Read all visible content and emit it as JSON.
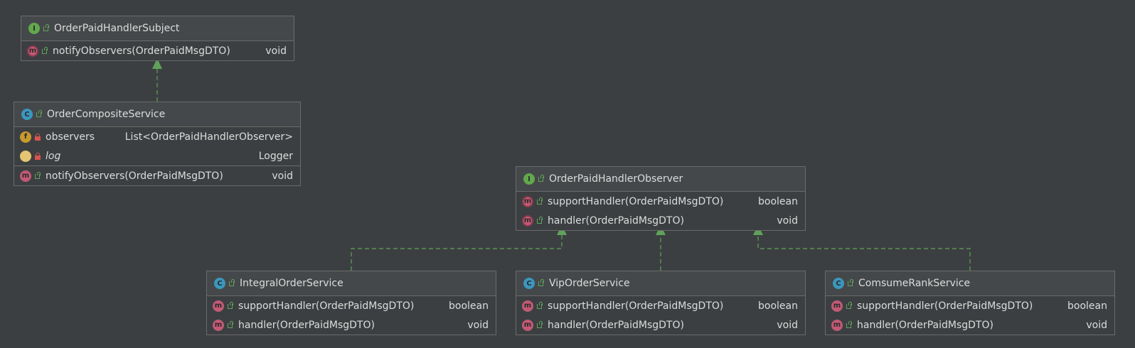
{
  "colors": {
    "background": "#3c3f41",
    "border": "#6a6a6a",
    "text": "#dcdcdc",
    "interface_badge": "#62a84c",
    "class_badge": "#3b97bd",
    "method_badge": "#c25a75",
    "field_badge": "#c79a2e",
    "arrow": "#5fa35a"
  },
  "nodes": {
    "subject": {
      "kind": "I",
      "name": "OrderPaidHandlerSubject",
      "methods": [
        {
          "kind": "m",
          "name": "notifyObservers(OrderPaidMsgDTO)",
          "type": "void"
        }
      ]
    },
    "composite": {
      "kind": "C",
      "name": "OrderCompositeService",
      "fields": [
        {
          "kind": "f",
          "name": "observers",
          "type": "List<OrderPaidHandlerObserver>"
        },
        {
          "kind": "f",
          "name": "log",
          "type": "Logger"
        }
      ],
      "methods": [
        {
          "kind": "m",
          "name": "notifyObservers(OrderPaidMsgDTO)",
          "type": "void"
        }
      ]
    },
    "observer": {
      "kind": "I",
      "name": "OrderPaidHandlerObserver",
      "methods": [
        {
          "kind": "m",
          "name": "supportHandler(OrderPaidMsgDTO)",
          "type": "boolean"
        },
        {
          "kind": "m",
          "name": "handler(OrderPaidMsgDTO)",
          "type": "void"
        }
      ]
    },
    "integral": {
      "kind": "C",
      "name": "IntegralOrderService",
      "methods": [
        {
          "kind": "m",
          "name": "supportHandler(OrderPaidMsgDTO)",
          "type": "boolean"
        },
        {
          "kind": "m",
          "name": "handler(OrderPaidMsgDTO)",
          "type": "void"
        }
      ]
    },
    "vip": {
      "kind": "C",
      "name": "VipOrderService",
      "methods": [
        {
          "kind": "m",
          "name": "supportHandler(OrderPaidMsgDTO)",
          "type": "boolean"
        },
        {
          "kind": "m",
          "name": "handler(OrderPaidMsgDTO)",
          "type": "void"
        }
      ]
    },
    "comsume": {
      "kind": "C",
      "name": "ComsumeRankService",
      "methods": [
        {
          "kind": "m",
          "name": "supportHandler(OrderPaidMsgDTO)",
          "type": "boolean"
        },
        {
          "kind": "m",
          "name": "handler(OrderPaidMsgDTO)",
          "type": "void"
        }
      ]
    }
  },
  "edges": [
    {
      "from": "composite",
      "to": "subject",
      "relation": "implements"
    },
    {
      "from": "integral",
      "to": "observer",
      "relation": "implements"
    },
    {
      "from": "vip",
      "to": "observer",
      "relation": "implements"
    },
    {
      "from": "comsume",
      "to": "observer",
      "relation": "implements"
    }
  ]
}
